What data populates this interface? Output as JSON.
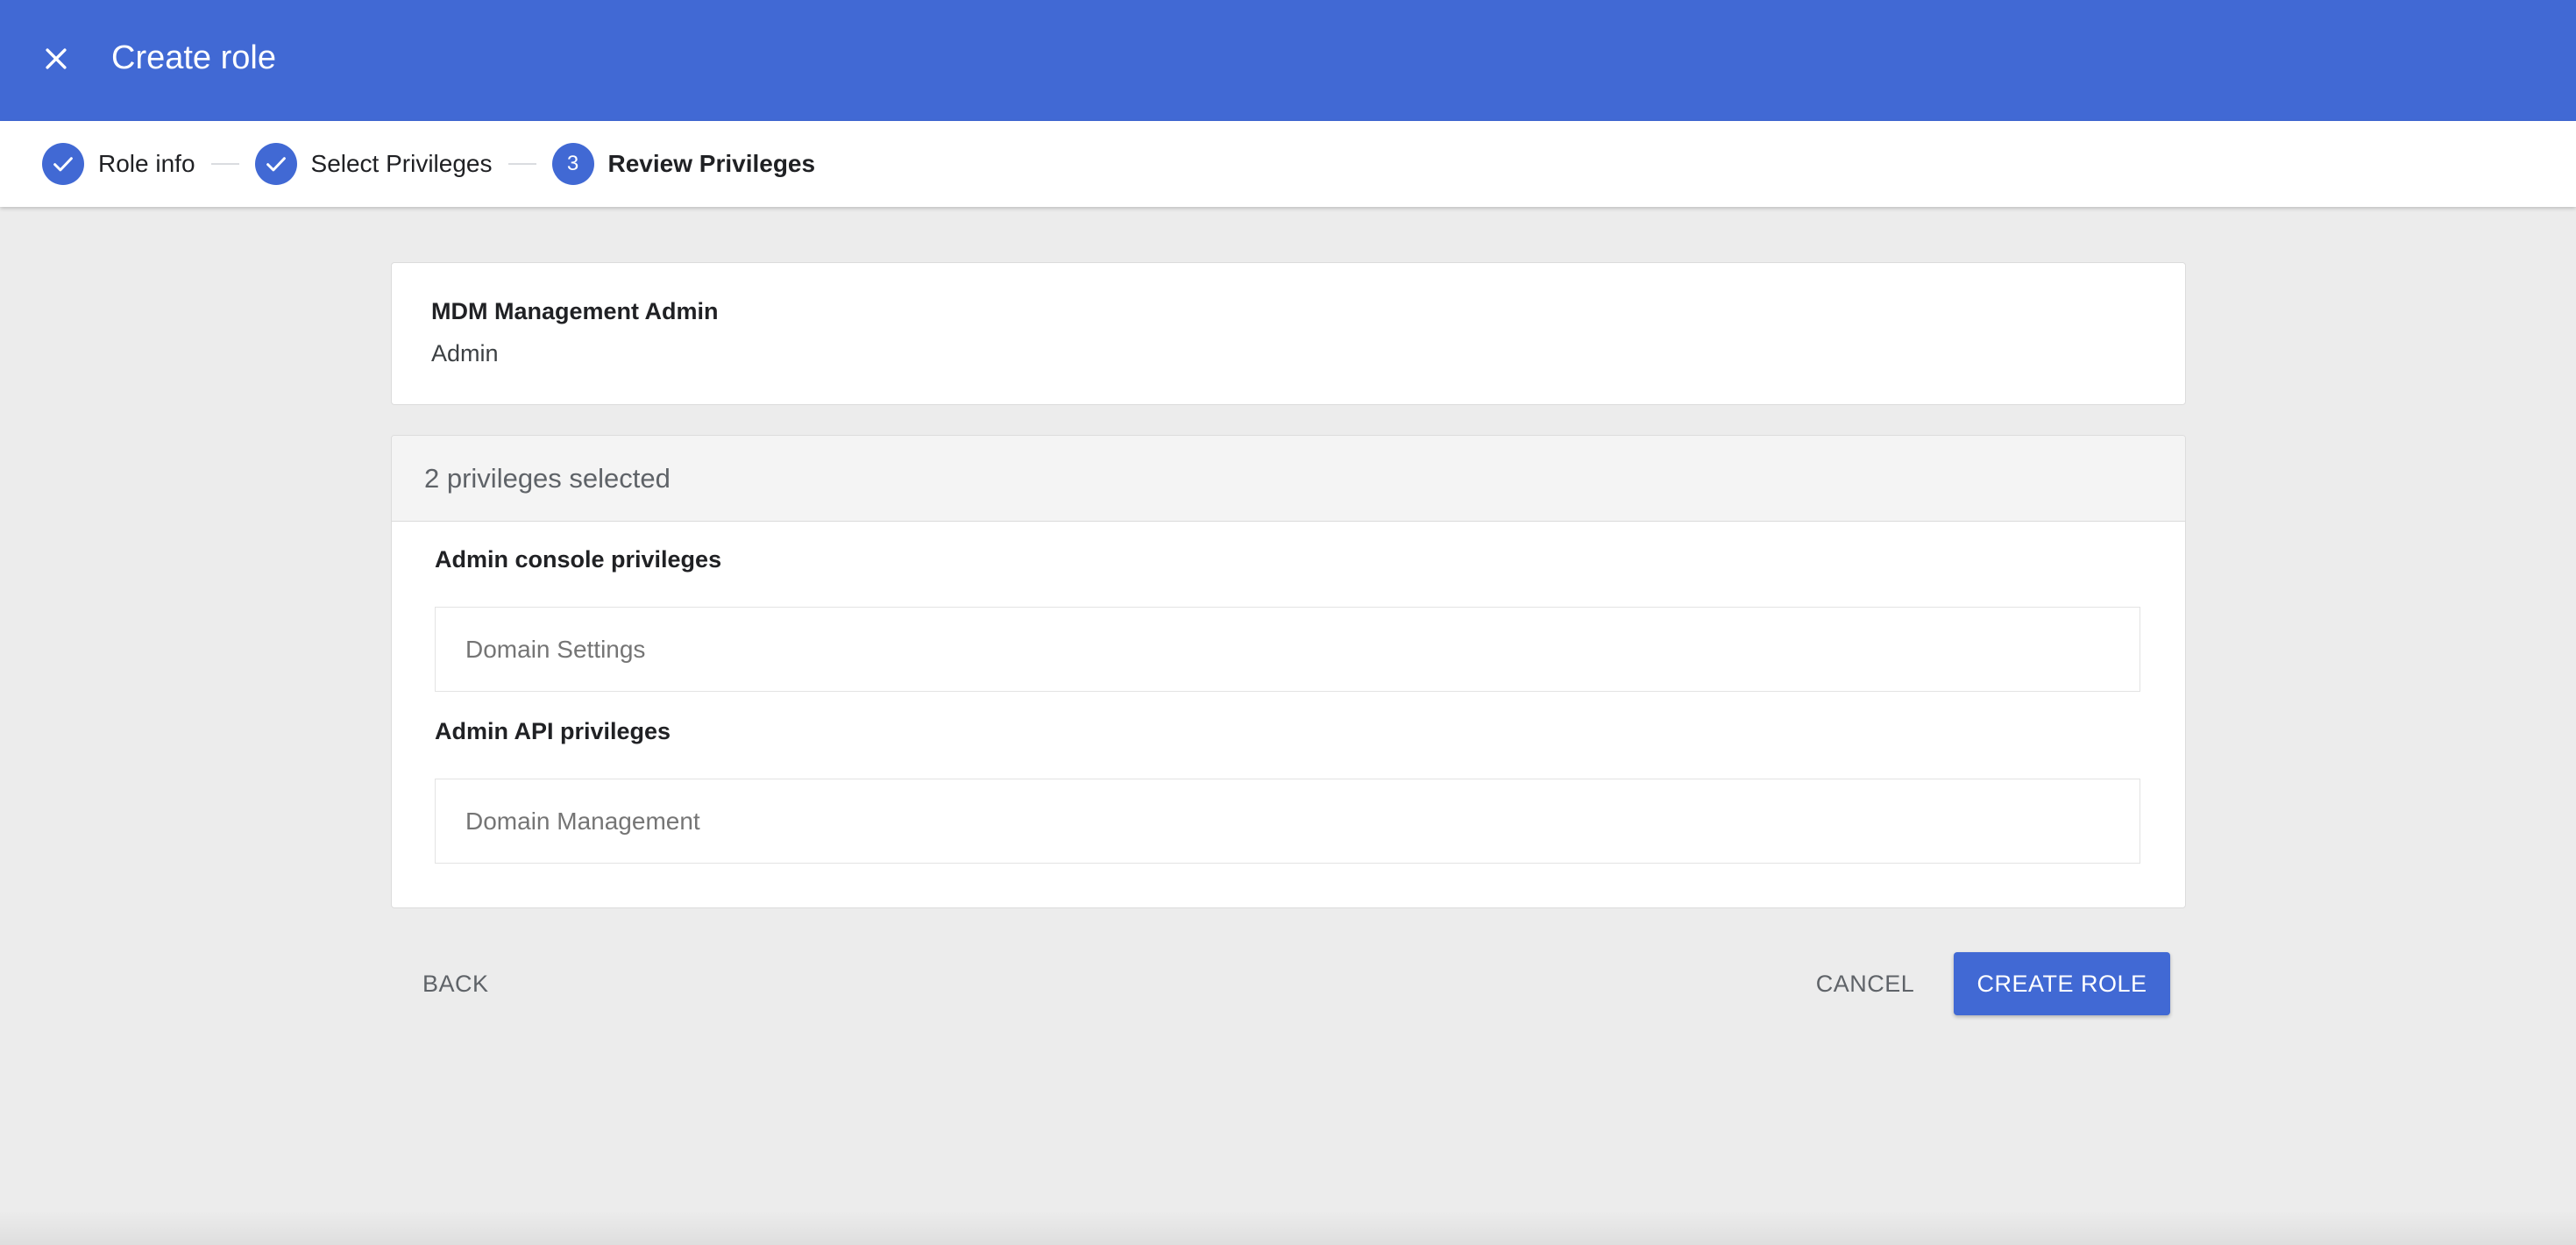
{
  "header": {
    "title": "Create role",
    "close_icon": "close-icon"
  },
  "stepper": {
    "steps": [
      {
        "label": "Role info",
        "state": "completed",
        "icon": "check-icon"
      },
      {
        "label": "Select Privileges",
        "state": "completed",
        "icon": "check-icon"
      },
      {
        "label": "Review Privileges",
        "state": "current",
        "number": "3"
      }
    ]
  },
  "role": {
    "name": "MDM Management Admin",
    "type": "Admin"
  },
  "privileges": {
    "summary": "2 privileges selected",
    "sections": [
      {
        "title": "Admin console privileges",
        "items": [
          "Domain Settings"
        ]
      },
      {
        "title": "Admin API privileges",
        "items": [
          "Domain Management"
        ]
      }
    ]
  },
  "actions": {
    "back": "BACK",
    "cancel": "CANCEL",
    "create": "CREATE ROLE"
  },
  "colors": {
    "primary": "#4169d4",
    "background": "#ececec"
  }
}
